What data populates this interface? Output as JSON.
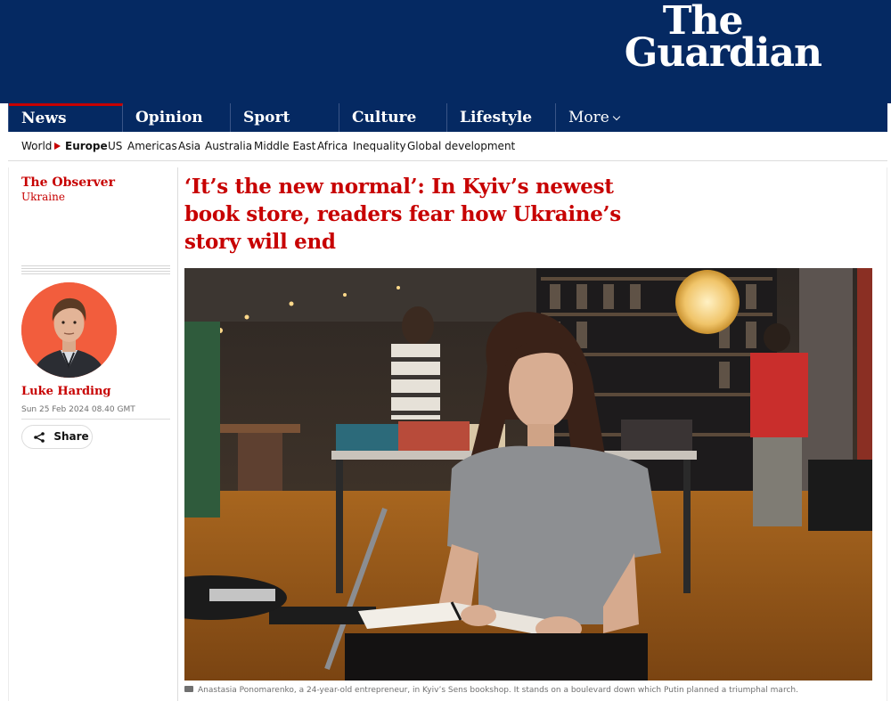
{
  "logo": {
    "line1": "The",
    "line2": "Guardian"
  },
  "pillars": [
    {
      "label": "News"
    },
    {
      "label": "Opinion"
    },
    {
      "label": "Sport"
    },
    {
      "label": "Culture"
    },
    {
      "label": "Lifestyle"
    },
    {
      "label": "More"
    }
  ],
  "subnav": {
    "items": [
      "World",
      "Europe",
      "US",
      "Americas",
      "Asia",
      "Australia",
      "Middle East",
      "Africa",
      "Inequality",
      "Global development"
    ]
  },
  "article": {
    "series": "The Observer",
    "section": "Ukraine",
    "headline_lines": [
      "‘It’s the new normal’: In Kyiv’s newest",
      "book store, readers fear how Ukraine’s",
      "story will end"
    ],
    "author": "Luke Harding",
    "date": "Sun 25 Feb 2024 08.40 GMT",
    "share_label": "Share",
    "caption": "Anastasia Ponomarenko, a 24-year-old entrepreneur, in Kyiv’s Sens bookshop. It stands on a boulevard down which Putin planned a triumphal march."
  },
  "colors": {
    "brand_blue": "#052962",
    "accent_red": "#c70000",
    "avatar_bg": "#f25d3d"
  }
}
